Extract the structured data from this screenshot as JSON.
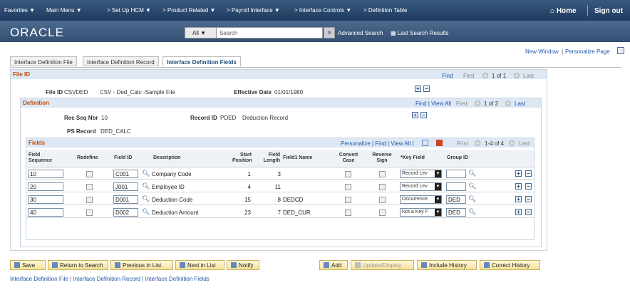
{
  "nav": {
    "favorites": "Favorites ▼",
    "main_menu": "Main Menu ▼",
    "crumbs": [
      "> Set Up HCM ▼",
      "> Product Related ▼",
      "> Payroll Interface ▼",
      "> Interface Controls ▼",
      "> Definition Table"
    ],
    "home": "Home",
    "signout": "Sign out"
  },
  "header": {
    "logo": "ORACLE",
    "search_scope": "All",
    "search_value": "Search",
    "advanced": "Advanced Search",
    "last_results": "Last Search Results"
  },
  "tabs": [
    "Interface Definition File",
    "Interface Definition Record",
    "Interface Definition Fields"
  ],
  "toplinks": {
    "new_window": "New Window",
    "personalize": "Personalize Page"
  },
  "file": {
    "title": "File ID",
    "find": "Find",
    "first": "First",
    "count": "1 of 1",
    "last": "Last",
    "file_id_label": "File ID",
    "file_id_value": "CSVDED",
    "file_desc": "CSV - Ded_Calc -Sample File",
    "eff_label": "Effective Date",
    "eff_value": "01/01/1980"
  },
  "definition": {
    "title": "Definition",
    "find_view": "Find | View All",
    "first": "First",
    "count": "1 of 2",
    "last": "Last",
    "rec_seq_label": "Rec Seq Nbr",
    "rec_seq_value": "10",
    "record_id_label": "Record ID",
    "record_id_value": "PDED",
    "record_desc": "Deduction Record",
    "ps_record_label": "PS Record",
    "ps_record_value": "DED_CALC"
  },
  "fields": {
    "title": "Fields",
    "toolbar": "Personalize | Find | View All |",
    "first": "First",
    "count": "1-4 of 4",
    "last": "Last",
    "columns": {
      "seq1": "Field",
      "seq2": "Sequence",
      "redefine": "Redefine",
      "field_id": "Field ID",
      "desc": "Description",
      "start1": "Start",
      "start2": "Position",
      "len1": "Field",
      "len2": "Length",
      "field1": "Field1 Name",
      "conv1": "Convert",
      "conv2": "Case",
      "rev1": "Reverse",
      "rev2": "Sign",
      "key": "*Key Field",
      "group": "Group ID"
    },
    "rows": [
      {
        "seq": "10",
        "field_id": "C001",
        "desc": "Company Code",
        "start": "1",
        "length": "3",
        "field1": "",
        "key": "Record Lev",
        "group": ""
      },
      {
        "seq": "20",
        "field_id": "J001",
        "desc": "Employee ID",
        "start": "4",
        "length": "11",
        "field1": "",
        "key": "Record Lev",
        "group": ""
      },
      {
        "seq": "30",
        "field_id": "D001",
        "desc": "Deduction Code",
        "start": "15",
        "length": "8",
        "field1": "DEDCD",
        "key": "Occurrence",
        "group": "DED"
      },
      {
        "seq": "40",
        "field_id": "D002",
        "desc": "Deduction Amount",
        "start": "23",
        "length": "7",
        "field1": "DED_CUR",
        "key": "Not a Key F",
        "group": "DED"
      }
    ]
  },
  "buttons": {
    "save": "Save",
    "return": "Return to Search",
    "prev": "Previous in List",
    "next": "Next in List",
    "notify": "Notify",
    "add": "Add",
    "update": "Update/Display",
    "include": "Include History",
    "correct": "Correct History"
  },
  "footer": "Interface Definition File | Interface Definition Record | Interface Definition Fields"
}
